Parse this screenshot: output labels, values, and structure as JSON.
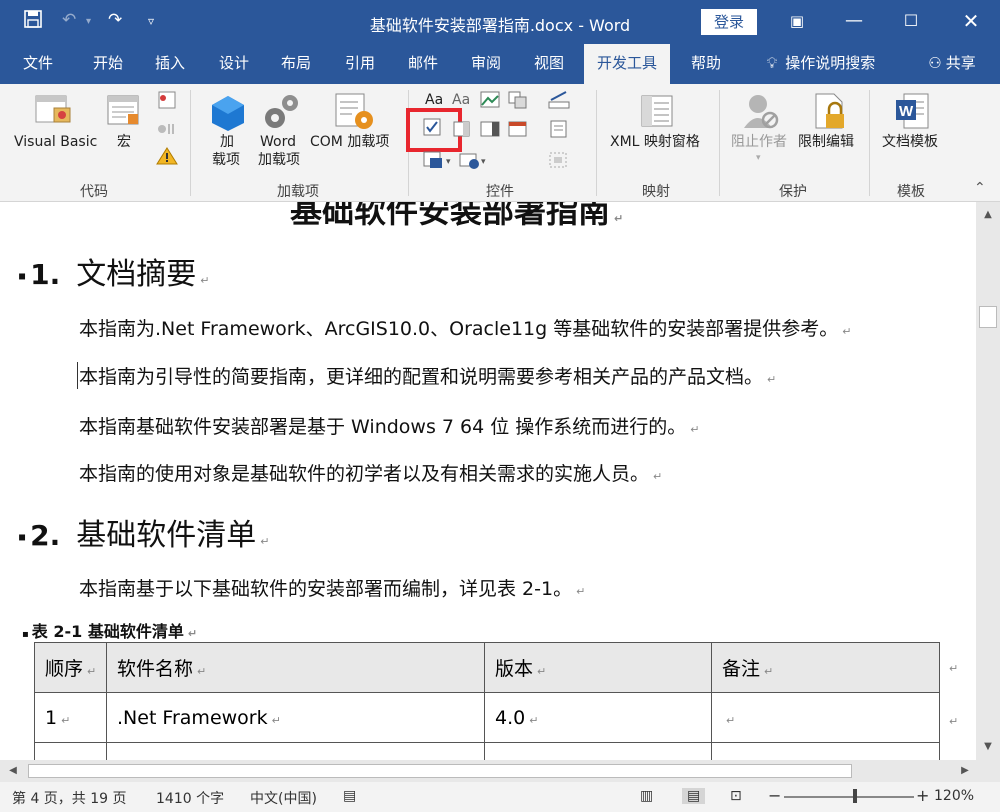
{
  "titlebar": {
    "save_icon": "save-icon",
    "title": "基础软件安装部署指南.docx - Word",
    "login_label": "登录"
  },
  "tabs": [
    "文件",
    "开始",
    "插入",
    "设计",
    "布局",
    "引用",
    "邮件",
    "审阅",
    "视图",
    "开发工具",
    "帮助"
  ],
  "tell_me": "操作说明搜索",
  "share": "共享",
  "ribbon": {
    "groups": {
      "code": "代码",
      "addins": "加载项",
      "controls": "控件",
      "mapping": "映射",
      "protect": "保护",
      "templates": "模板"
    },
    "visual_basic": "Visual Basic",
    "macros": "宏",
    "addin_1": "加",
    "addin_2": "载项",
    "word_addin_1": "Word",
    "word_addin_2": "加载项",
    "com_addin": "COM 加载项",
    "xml_mapping": "XML 映射窗格",
    "block_authors": "阻止作者",
    "restrict_editing": "限制编辑",
    "doc_template": "文档模板"
  },
  "doc": {
    "cut_title": "基础软件安装部署指南",
    "h1_num": "1.",
    "h1_text": "文档摘要",
    "p1": "本指南为.Net Framework、ArcGIS10.0、Oracle11g 等基础软件的安装部署提供参考。",
    "p2": "本指南为引导性的简要指南，更详细的配置和说明需要参考相关产品的产品文档。",
    "p3": "本指南基础软件安装部署是基于  Windows 7 64 位  操作系统而进行的。",
    "p4": "本指南的使用对象是基础软件的初学者以及有相关需求的实施人员。",
    "h2_num": "2.",
    "h2_text": "基础软件清单",
    "p5": "本指南基于以下基础软件的安装部署而编制，详见表 2-1。",
    "caption": "表  2-1  基础软件清单",
    "table": {
      "headers": [
        "顺序",
        "软件名称",
        "版本",
        "备注"
      ],
      "rows": [
        [
          "1",
          ".Net Framework",
          "4.0",
          ""
        ]
      ]
    }
  },
  "status": {
    "page": "第 4 页，共 19 页",
    "words": "1410 个字",
    "lang": "中文(中国)",
    "zoom": "120%"
  },
  "colors": {
    "brand": "#2b579a",
    "highlight": "#e8262e"
  }
}
